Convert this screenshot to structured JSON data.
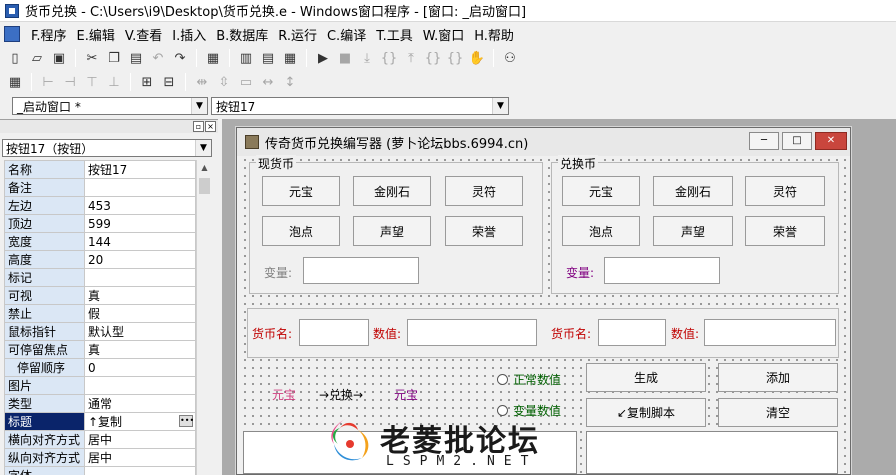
{
  "window": {
    "title": "货币兑换 - C:\\Users\\i9\\Desktop\\货币兑换.e - Windows窗口程序 - [窗口: _启动窗口]"
  },
  "menu": [
    "F.程序",
    "E.编辑",
    "V.查看",
    "I.插入",
    "B.数据库",
    "R.运行",
    "C.编译",
    "T.工具",
    "W.窗口",
    "H.帮助"
  ],
  "toolbar_icons": [
    "new-icon",
    "open-icon",
    "save-icon",
    "cut-icon",
    "copy-icon",
    "paste-icon",
    "undo-icon",
    "redo-icon",
    "find-icon",
    "layout1-icon",
    "layout2-icon",
    "layout3-icon",
    "run-icon",
    "stop-icon",
    "step-icon",
    "binoculars-icon"
  ],
  "combos": {
    "window_select": "_启动窗口 *",
    "component_select": "按钮17"
  },
  "properties": {
    "component_select": "按钮17（按钮）",
    "rows": [
      {
        "key": "名称",
        "value": "按钮17"
      },
      {
        "key": "备注",
        "value": ""
      },
      {
        "key": "左边",
        "value": "453"
      },
      {
        "key": "顶边",
        "value": "599"
      },
      {
        "key": "宽度",
        "value": "144"
      },
      {
        "key": "高度",
        "value": "20"
      },
      {
        "key": "标记",
        "value": ""
      },
      {
        "key": "可视",
        "value": "真"
      },
      {
        "key": "禁止",
        "value": "假"
      },
      {
        "key": "鼠标指针",
        "value": "默认型"
      },
      {
        "key": "可停留焦点",
        "value": "真"
      },
      {
        "key": "停留顺序",
        "value": "0"
      },
      {
        "key": "图片",
        "value": ""
      },
      {
        "key": "类型",
        "value": "通常"
      },
      {
        "key": "标题",
        "value": "↑复制"
      },
      {
        "key": "横向对齐方式",
        "value": "居中"
      },
      {
        "key": "纵向对齐方式",
        "value": "居中"
      },
      {
        "key": "字体",
        "value": ""
      }
    ]
  },
  "form": {
    "title": "传奇货币兑换编写器 (萝卜论坛bbs.6994.cn)",
    "group_current": {
      "label": "现货币",
      "buttons": [
        "元宝",
        "金刚石",
        "灵符",
        "泡点",
        "声望",
        "荣誉"
      ],
      "var_label": "变量:"
    },
    "group_exchange": {
      "label": "兑换币",
      "buttons": [
        "元宝",
        "金刚石",
        "灵符",
        "泡点",
        "声望",
        "荣誉"
      ],
      "var_label": "变量:"
    },
    "row2": {
      "currency_label_1": "货币名:",
      "value_label_1": "数值:",
      "currency_label_2": "货币名:",
      "value_label_2": "数值:"
    },
    "preview": {
      "left": "元宝",
      "arrow": "→兑换→",
      "right": "元宝"
    },
    "radios": [
      "正常数值",
      "变量数值"
    ],
    "actions": {
      "generate": "生成",
      "add": "添加",
      "copy_script": "↙复制脚本",
      "clear": "清空"
    }
  },
  "watermark": {
    "text": "老菱批论坛",
    "sub": "LSPM2.NET"
  },
  "colors": {
    "selected_row": "#0a246a",
    "prop_key_bg": "#dbe7f5",
    "label_red": "#c00000",
    "label_purple": "#800080",
    "label_green": "#006000"
  }
}
